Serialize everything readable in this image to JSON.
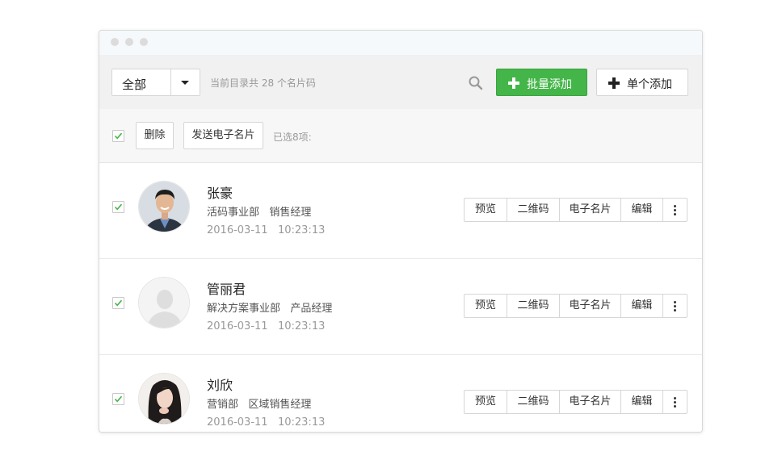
{
  "colors": {
    "accent_green": "#44b549",
    "check_green": "#44b549"
  },
  "toolbar": {
    "filter_value": "全部",
    "directory_count": "当前目录共 28 个名片码",
    "bulk_add_label": "批量添加",
    "single_add_label": "单个添加"
  },
  "bulkbar": {
    "select_all_checked": true,
    "delete_label": "删除",
    "send_card_label": "发送电子名片",
    "selected_text": "已选8项:"
  },
  "rows": [
    {
      "checked": true,
      "name": "张豪",
      "dept": "活码事业部",
      "title": "销售经理",
      "date": "2016-03-11",
      "time": "10:23:13",
      "actions": [
        "预览",
        "二维码",
        "电子名片",
        "编辑"
      ]
    },
    {
      "checked": true,
      "name": "管丽君",
      "dept": "解决方案事业部",
      "title": "产品经理",
      "date": "2016-03-11",
      "time": "10:23:13",
      "actions": [
        "预览",
        "二维码",
        "电子名片",
        "编辑"
      ]
    },
    {
      "checked": true,
      "name": "刘欣",
      "dept": "营销部",
      "title": "区域销售经理",
      "date": "2016-03-11",
      "time": "10:23:13",
      "actions": [
        "预览",
        "二维码",
        "电子名片",
        "编辑"
      ]
    }
  ]
}
